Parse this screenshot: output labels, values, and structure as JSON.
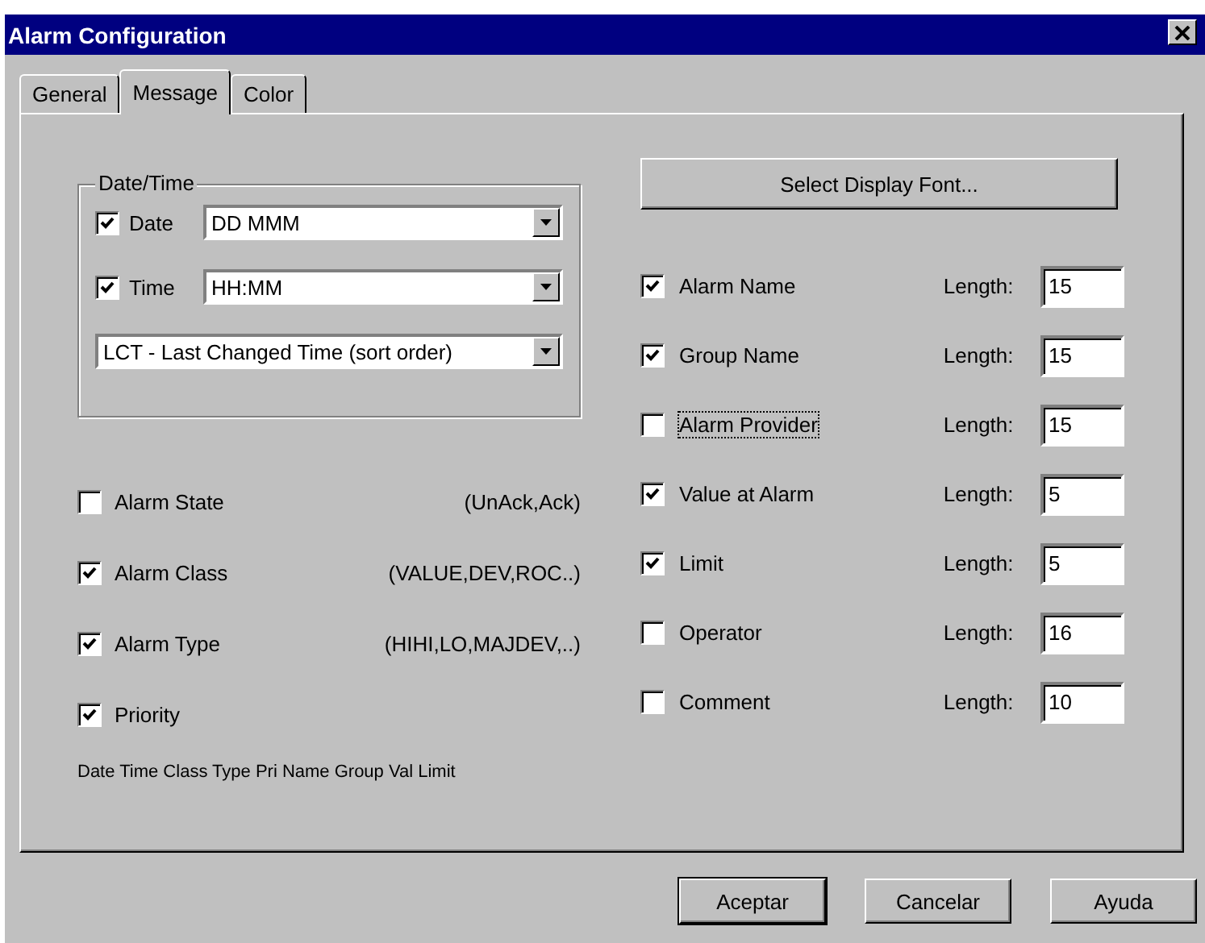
{
  "window": {
    "title": "Alarm Configuration"
  },
  "tabs": [
    {
      "label": "General",
      "selected": false
    },
    {
      "label": "Message",
      "selected": true
    },
    {
      "label": "Color",
      "selected": false
    }
  ],
  "date_time": {
    "label": "Date/Time",
    "fields": [
      {
        "label": "Date",
        "checked": true,
        "value": "DD MMM"
      },
      {
        "label": "Time",
        "checked": true,
        "value": "HH:MM"
      }
    ],
    "sort_order": "LCT - Last Changed Time (sort order)"
  },
  "left_options": [
    {
      "label": "Alarm State",
      "checked": false,
      "hint": "(UnAck,Ack)"
    },
    {
      "label": "Alarm Class",
      "checked": true,
      "hint": "(VALUE,DEV,ROC..)"
    },
    {
      "label": "Alarm Type",
      "checked": true,
      "hint": "(HIHI,LO,MAJDEV,..)"
    },
    {
      "label": "Priority",
      "checked": true
    }
  ],
  "preview": "Date Time Class Type Pri Name Group Val Limit",
  "font_button": "Select Display Font...",
  "fields": [
    {
      "label": "Alarm Name",
      "checked": true,
      "focused": false,
      "length_label": "Length:",
      "length": "15"
    },
    {
      "label": "Group Name",
      "checked": true,
      "focused": false,
      "length_label": "Length:",
      "length": "15"
    },
    {
      "label": "Alarm Provider",
      "checked": false,
      "focused": true,
      "length_label": "Length:",
      "length": "15"
    },
    {
      "label": "Value at Alarm",
      "checked": true,
      "focused": false,
      "length_label": "Length:",
      "length": "5"
    },
    {
      "label": "Limit",
      "checked": true,
      "focused": false,
      "length_label": "Length:",
      "length": "5"
    },
    {
      "label": "Operator",
      "checked": false,
      "focused": false,
      "length_label": "Length:",
      "length": "16"
    },
    {
      "label": "Comment",
      "checked": false,
      "focused": false,
      "length_label": "Length:",
      "length": "10"
    }
  ],
  "buttons": [
    {
      "label": "Aceptar",
      "default": true
    },
    {
      "label": "Cancelar",
      "default": false
    },
    {
      "label": "Ayuda",
      "default": false
    }
  ]
}
